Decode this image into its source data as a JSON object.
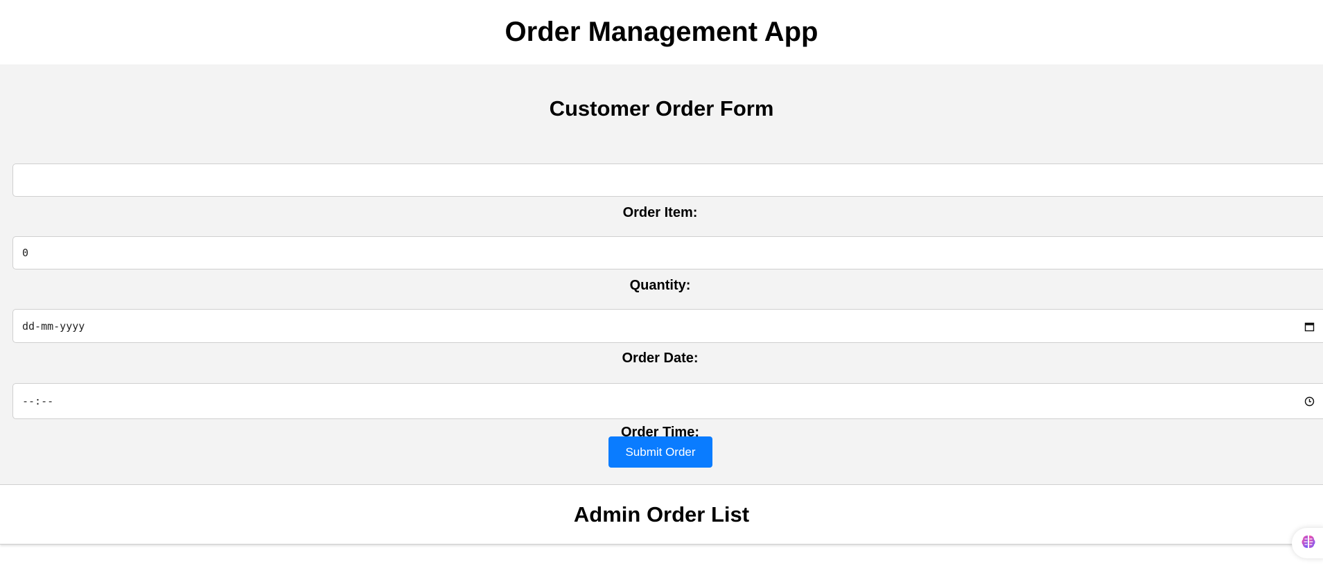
{
  "header": {
    "title": "Order Management App"
  },
  "form": {
    "title": "Customer Order Form",
    "fields": [
      {
        "label": "Order Item:",
        "value": "",
        "placeholder": ""
      },
      {
        "label": "Quantity:",
        "value": "0",
        "placeholder": ""
      },
      {
        "label": "Order Date:",
        "value": "dd-mm-yyyy",
        "icon": "calendar-icon"
      },
      {
        "label": "Order Time:",
        "value": "--:--",
        "icon": "clock-icon"
      }
    ],
    "submit_label": "Submit Order"
  },
  "admin": {
    "title": "Admin Order List"
  },
  "widget": {
    "icon": "brain-icon"
  },
  "colors": {
    "accent": "#0a7cff",
    "form_background": "#f3f3f3"
  }
}
